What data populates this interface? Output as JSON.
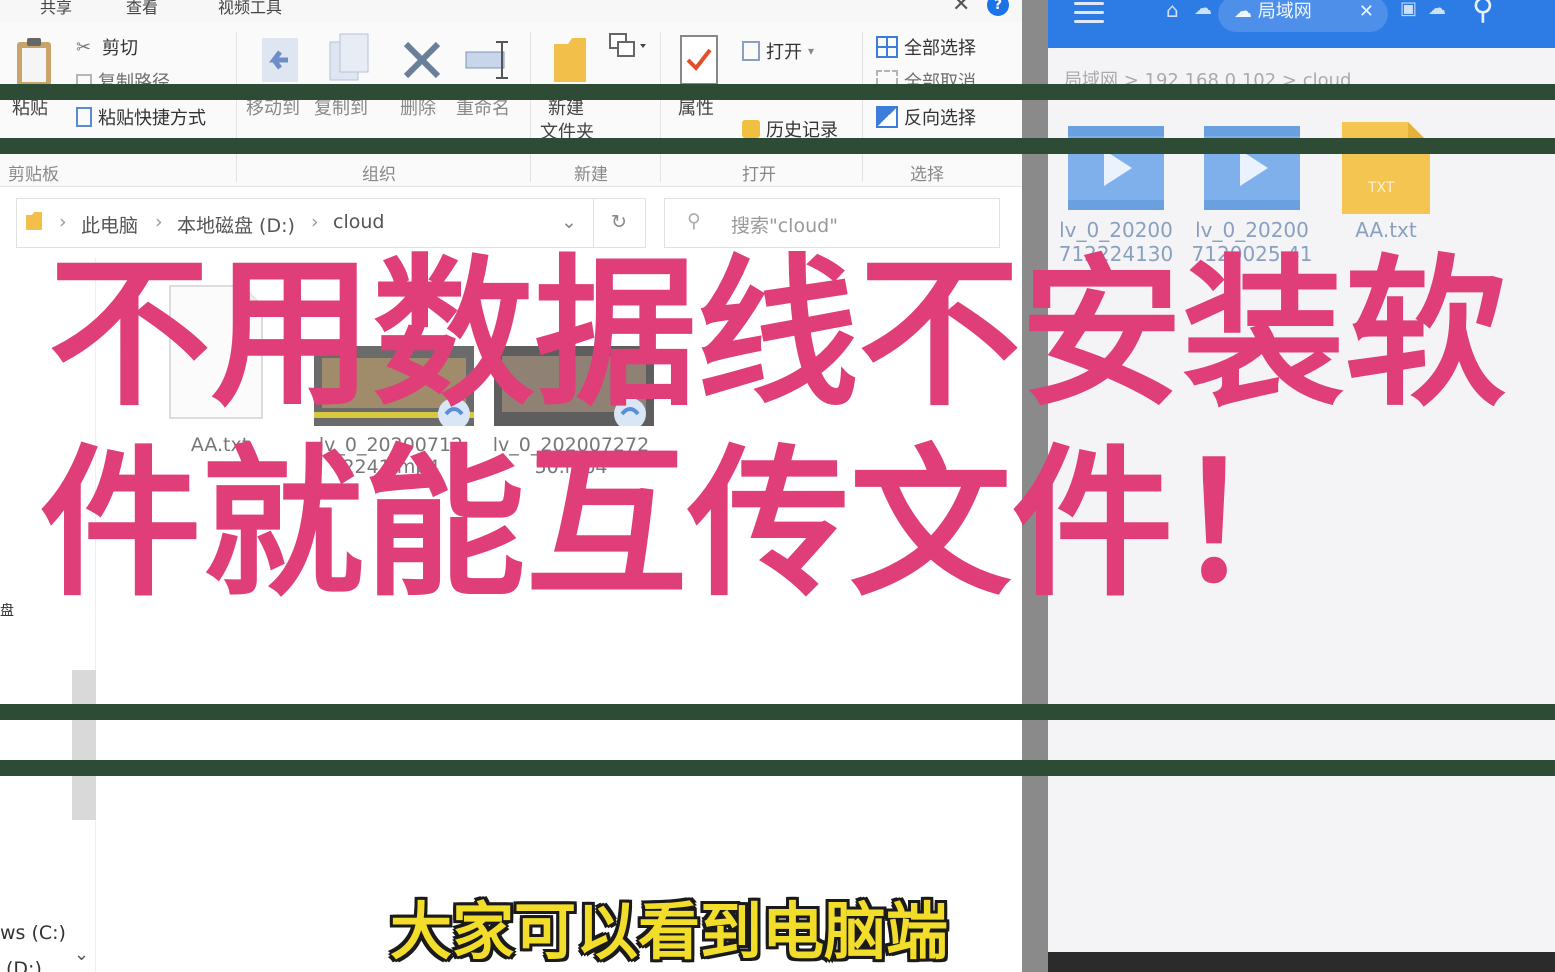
{
  "explorer": {
    "ribbon_tabs": [
      "共享",
      "查看",
      "视频工具"
    ],
    "clipboard": {
      "paste_label": "粘贴",
      "cut_label": "剪切",
      "copy_path_label": "复制路径",
      "paste_shortcut_label": "粘贴快捷方式",
      "group_label": "剪贴板"
    },
    "organize": {
      "move_to_label": "移动到",
      "copy_to_label": "复制到",
      "delete_label": "删除",
      "rename_label": "重命名",
      "group_label": "组织"
    },
    "new": {
      "new_folder_label_line1": "新建",
      "new_folder_label_line2": "文件夹",
      "group_label": "新建"
    },
    "open": {
      "properties_label": "属性",
      "open_label": "打开",
      "history_label": "历史记录",
      "group_label": "打开"
    },
    "select": {
      "select_all_label": "全部选择",
      "select_none_label": "全部取消",
      "invert_label": "反向选择",
      "group_label": "选择"
    },
    "address": {
      "crumbs": [
        "此电脑",
        "本地磁盘 (D:)",
        "cloud"
      ]
    },
    "search_placeholder": "搜索\"cloud\"",
    "nav": {
      "item_drive_c": "ws (C:)",
      "item_drive_d": "(D:)",
      "item_disk": "盘"
    },
    "files": [
      {
        "name": "AA.txt"
      },
      {
        "name_line1": "lv_0_20200712",
        "name_line2": "2241.mp4"
      },
      {
        "name_line1": "lv_0_202007272",
        "name_line2": "50.mp4"
      }
    ]
  },
  "phone": {
    "location_chip": "局域网",
    "path": "局域网 > 192.168.0.102 > cloud",
    "files": [
      {
        "name_line1": "lv_0_20200",
        "name_line2": "712224130"
      },
      {
        "name_line1": "lv_0_20200",
        "name_line2": "7120025 41"
      },
      {
        "name_line1": "AA.txt",
        "name_line2": ""
      }
    ],
    "txt_badge": "TXT"
  },
  "overlay": {
    "title_line1": "不用数据线不安装软",
    "title_line2": "件就能互传文件！",
    "subtitle": "大家可以看到电脑端"
  },
  "colors": {
    "title": "#df3e78",
    "subtitle": "#f3dd2b",
    "stripe": "#2e4c35",
    "phone_accent": "#2d7be5"
  }
}
